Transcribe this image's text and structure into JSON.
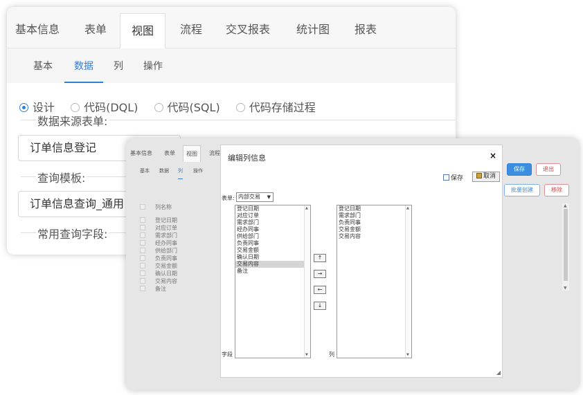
{
  "back": {
    "tabs": [
      "基本信息",
      "表单",
      "视图",
      "流程",
      "交叉报表",
      "统计图",
      "报表"
    ],
    "subtabs": [
      "基本",
      "数据",
      "列",
      "操作"
    ],
    "radios": [
      "设计",
      "代码(DQL)",
      "代码(SQL)",
      "代码存储过程"
    ],
    "source_label": "数据来源表单:",
    "source_value": "订单信息登记",
    "template_label": "查询模板:",
    "template_value": "订单信息查询_通用",
    "fields_label": "常用查询字段:"
  },
  "panel": {
    "tabs": [
      "基本信息",
      "表单",
      "视图",
      "流程"
    ],
    "subtabs": [
      "基本",
      "数据",
      "列",
      "操作"
    ],
    "col_header": "列名称",
    "cols": [
      "登记日期",
      "对应订单",
      "需求部门",
      "经办同事",
      "供给部门",
      "负责同事",
      "交易金额",
      "确认日期",
      "交易内容",
      "备注"
    ],
    "save": "保存",
    "exit": "退出",
    "batch": "批量创建",
    "remove": "移除"
  },
  "dialog": {
    "title": "编辑列信息",
    "close": "×",
    "save_check": "保存",
    "cancel": "取消",
    "table_label": "表单:",
    "table_value": "内部交易",
    "field_label": "字段",
    "col_label": "列",
    "left_items": [
      "登记日期",
      "对应订单",
      "需求部门",
      "经办同事",
      "供给部门",
      "负责同事",
      "交易金额",
      "确认日期",
      "交易内容",
      "备注"
    ],
    "right_items": [
      "登记日期",
      "需求部门",
      "负责同事",
      "交易金额",
      "交易内容"
    ],
    "move_up": "↑",
    "move_right": "→",
    "move_left": "←",
    "move_down": "↓"
  }
}
